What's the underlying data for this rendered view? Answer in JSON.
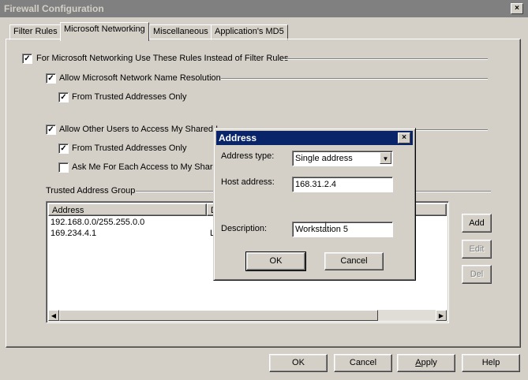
{
  "window": {
    "title": "Firewall Configuration",
    "close": "×"
  },
  "tabs": [
    "Filter Rules",
    "Microsoft Networking",
    "Miscellaneous",
    "Application's MD5"
  ],
  "options": {
    "use_rules": "For Microsoft Networking Use These Rules Instead of Filter Rules",
    "allow_name_resolution": "Allow Microsoft Network Name Resolution",
    "trusted_only_1": "From Trusted Addresses Only",
    "allow_shared": "Allow Other Users to Access My Shared I",
    "trusted_only_2": "From Trusted Addresses Only",
    "ask_me": "Ask Me For Each Access to My Share",
    "check": "✓"
  },
  "group": {
    "title": "Trusted Address Group",
    "columns": [
      "Address",
      "D"
    ],
    "rows": [
      {
        "address": "192.168.0.0/255.255.0.0",
        "desc": ""
      },
      {
        "address": "169.234.4.1",
        "desc": "L"
      }
    ]
  },
  "side_buttons": {
    "add": "Add",
    "edit": "Edit",
    "del": "Del"
  },
  "bottom_buttons": {
    "ok": "OK",
    "cancel": "Cancel",
    "apply": "Apply",
    "help": "Help"
  },
  "dialog": {
    "title": "Address",
    "close": "×",
    "type_label": "Address type:",
    "type_value": "Single address",
    "host_label": "Host address:",
    "host_value": "168.31.2.4",
    "desc_label": "Description:",
    "desc_value": "Workstation 5",
    "ok": "OK",
    "cancel": "Cancel"
  }
}
